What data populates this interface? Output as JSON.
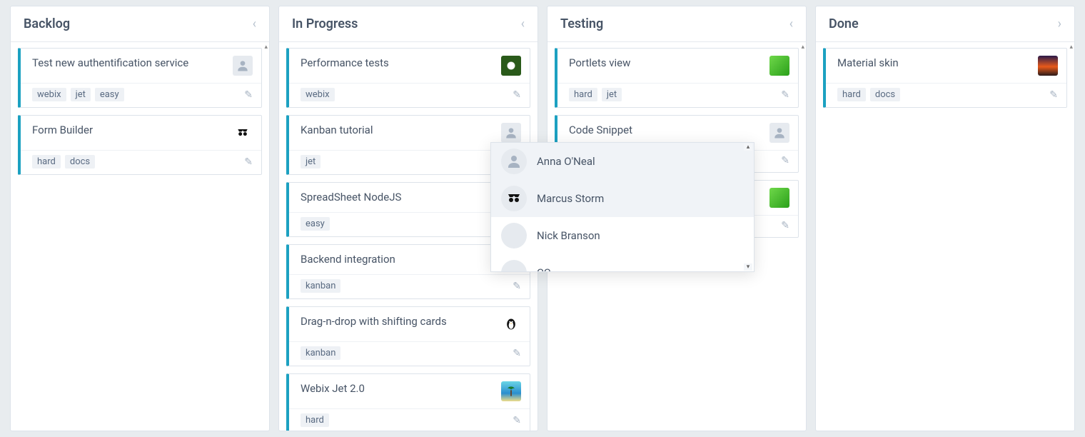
{
  "columns": [
    {
      "id": "backlog",
      "title": "Backlog",
      "chevron": "left",
      "cards": [
        {
          "title": "Test new authentification service",
          "tags": [
            "webix",
            "jet",
            "easy"
          ],
          "avatar": "person"
        },
        {
          "title": "Form Builder",
          "tags": [
            "hard",
            "docs"
          ],
          "avatar": "glasses"
        }
      ]
    },
    {
      "id": "progress",
      "title": "In Progress",
      "chevron": "left",
      "cards": [
        {
          "title": "Performance tests",
          "tags": [
            "webix"
          ],
          "avatar": "flower"
        },
        {
          "title": "Kanban tutorial",
          "tags": [
            "jet"
          ],
          "avatar": "person"
        },
        {
          "title": "SpreadSheet NodeJS",
          "tags": [
            "easy"
          ],
          "avatar": null
        },
        {
          "title": "Backend integration",
          "tags": [
            "kanban"
          ],
          "avatar": null
        },
        {
          "title": "Drag-n-drop with shifting cards",
          "tags": [
            "kanban"
          ],
          "avatar": "penguin"
        },
        {
          "title": "Webix Jet 2.0",
          "tags": [
            "hard"
          ],
          "avatar": "palm"
        }
      ]
    },
    {
      "id": "testing",
      "title": "Testing",
      "chevron": "left",
      "cards": [
        {
          "title": "Portlets view",
          "tags": [
            "hard",
            "jet"
          ],
          "avatar": "green"
        },
        {
          "title": "Code Snippet",
          "tags": [],
          "avatar": "person"
        },
        {
          "title": "",
          "tags": [],
          "avatar": "green",
          "partial": true
        }
      ]
    },
    {
      "id": "done",
      "title": "Done",
      "chevron": "right",
      "cards": [
        {
          "title": "Material skin",
          "tags": [
            "hard",
            "docs"
          ],
          "avatar": "sunset"
        }
      ]
    }
  ],
  "user_popup": {
    "visible": true,
    "anchor_column": "testing",
    "options": [
      {
        "name": "Anna O'Neal",
        "avatar": "person",
        "selected": true
      },
      {
        "name": "Marcus Storm",
        "avatar": "glasses",
        "selected": true
      },
      {
        "name": "Nick Branson",
        "avatar": "sunset",
        "selected": false
      },
      {
        "name": "CC",
        "avatar": "green",
        "selected": false
      }
    ]
  }
}
